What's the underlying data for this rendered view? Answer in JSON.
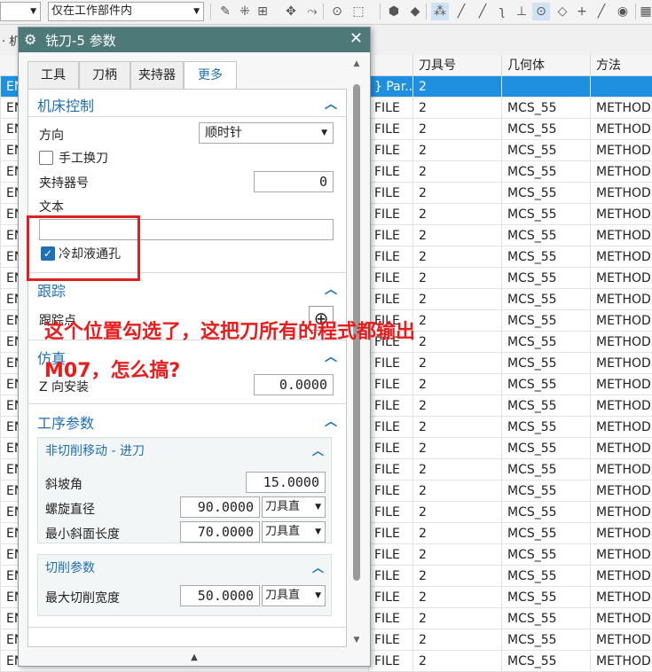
{
  "toolbar": {
    "scope_select": "仅在工作部件内"
  },
  "strip": {
    "menu_frag": "· 机"
  },
  "table": {
    "headers": [
      "刀具号",
      "几何体",
      "方法"
    ],
    "rows": [
      {
        "c0": "ENG",
        "c1": "} Par...",
        "c2": "2",
        "c3": "",
        "c4": ""
      },
      {
        "c0": "ENG",
        "c1": "FILE",
        "c2": "2",
        "c3": "MCS_55",
        "c4": "METHOD"
      },
      {
        "c0": "ENG",
        "c1": "FILE",
        "c2": "2",
        "c3": "MCS_55",
        "c4": "METHOD"
      },
      {
        "c0": "ENG",
        "c1": "FILE",
        "c2": "2",
        "c3": "MCS_55",
        "c4": "METHOD"
      },
      {
        "c0": "ENG",
        "c1": "FILE",
        "c2": "2",
        "c3": "MCS_55",
        "c4": "METHOD"
      },
      {
        "c0": "ENG",
        "c1": "FILE",
        "c2": "2",
        "c3": "MCS_55",
        "c4": "METHOD"
      },
      {
        "c0": "ENG",
        "c1": "FILE",
        "c2": "2",
        "c3": "MCS_55",
        "c4": "METHOD"
      },
      {
        "c0": "ENG",
        "c1": "FILE",
        "c2": "2",
        "c3": "MCS_55",
        "c4": "METHOD"
      },
      {
        "c0": "ENG",
        "c1": "FILE",
        "c2": "2",
        "c3": "MCS_55",
        "c4": "METHOD"
      },
      {
        "c0": "ENG",
        "c1": "FILE",
        "c2": "2",
        "c3": "MCS_55",
        "c4": "METHOD"
      },
      {
        "c0": "ENG",
        "c1": "FILE",
        "c2": "2",
        "c3": "MCS_55",
        "c4": "METHOD"
      },
      {
        "c0": "ENG",
        "c1": "FILE",
        "c2": "2",
        "c3": "MCS_55",
        "c4": "METHOD"
      },
      {
        "c0": "ENG",
        "c1": "FILE",
        "c2": "2",
        "c3": "MCS_55",
        "c4": "METHOD"
      },
      {
        "c0": "ENG",
        "c1": "FILE",
        "c2": "2",
        "c3": "MCS_55",
        "c4": "METHOD"
      },
      {
        "c0": "ENG",
        "c1": "FILE",
        "c2": "2",
        "c3": "MCS_55",
        "c4": "METHOD"
      },
      {
        "c0": "ENG",
        "c1": "FILE",
        "c2": "2",
        "c3": "MCS_55",
        "c4": "METHOD"
      },
      {
        "c0": "ENG",
        "c1": "FILE",
        "c2": "2",
        "c3": "MCS_55",
        "c4": "METHOD"
      },
      {
        "c0": "ENG",
        "c1": "FILE",
        "c2": "2",
        "c3": "MCS_55",
        "c4": "METHOD"
      },
      {
        "c0": "ENG",
        "c1": "FILE",
        "c2": "2",
        "c3": "MCS_55",
        "c4": "METHOD"
      },
      {
        "c0": "ENG",
        "c1": "FILE",
        "c2": "2",
        "c3": "MCS_55",
        "c4": "METHOD"
      },
      {
        "c0": "ENG",
        "c1": "FILE",
        "c2": "2",
        "c3": "MCS_55",
        "c4": "METHOD"
      },
      {
        "c0": "ENG",
        "c1": "FILE",
        "c2": "2",
        "c3": "MCS_55",
        "c4": "METHOD"
      },
      {
        "c0": "ENG",
        "c1": "FILE",
        "c2": "2",
        "c3": "MCS_55",
        "c4": "METHOD"
      },
      {
        "c0": "ENG",
        "c1": "FILE",
        "c2": "2",
        "c3": "MCS_55",
        "c4": "METHOD"
      },
      {
        "c0": "ENG",
        "c1": "FILE",
        "c2": "2",
        "c3": "MCS_55",
        "c4": "METHOD"
      },
      {
        "c0": "ENG",
        "c1": "FILE",
        "c2": "2",
        "c3": "MCS_55",
        "c4": "METHOD"
      },
      {
        "c0": "ENG",
        "c1": "FILE",
        "c2": "2",
        "c3": "MCS_55",
        "c4": "METHOD"
      },
      {
        "c0": "ENG",
        "c1": "FILE",
        "c2": "2",
        "c3": "MCS_55",
        "c4": "METHOD"
      }
    ]
  },
  "dialog": {
    "title": "铣刀-5 参数",
    "tabs": [
      "工具",
      "刀柄",
      "夹持器",
      "更多"
    ],
    "sections": {
      "machine": {
        "title": "机床控制",
        "direction_label": "方向",
        "direction_value": "顺时针",
        "manual_change_label": "手工换刀",
        "holder_number_label": "夹持器号",
        "holder_number_value": "0",
        "text_label": "文本",
        "text_value": "",
        "coolant_label": "冷却液通孔"
      },
      "tracking": {
        "title": "跟踪",
        "tracking_point_label": "跟踪点"
      },
      "simulation": {
        "title": "仿真",
        "z_install_label": "Z 向安装",
        "z_install_value": "0.0000"
      },
      "operation": {
        "title": "工序参数",
        "noncut": {
          "title": "非切削移动 - 进刀",
          "ramp_angle_label": "斜坡角",
          "ramp_angle_value": "15.0000",
          "helix_dia_label": "螺旋直径",
          "helix_dia_value": "90.0000",
          "helix_dia_unit": "刀具直",
          "min_ramp_label": "最小斜面长度",
          "min_ramp_value": "70.0000",
          "min_ramp_unit": "刀具直"
        },
        "cutting": {
          "title": "切削参数",
          "max_width_label": "最大切削宽度",
          "max_width_value": "50.0000",
          "max_width_unit": "刀具直"
        }
      }
    }
  },
  "annotation": {
    "line1": "这个位置勾选了，这把刀所有的程式都输出",
    "line2": "M07，怎么搞?"
  }
}
